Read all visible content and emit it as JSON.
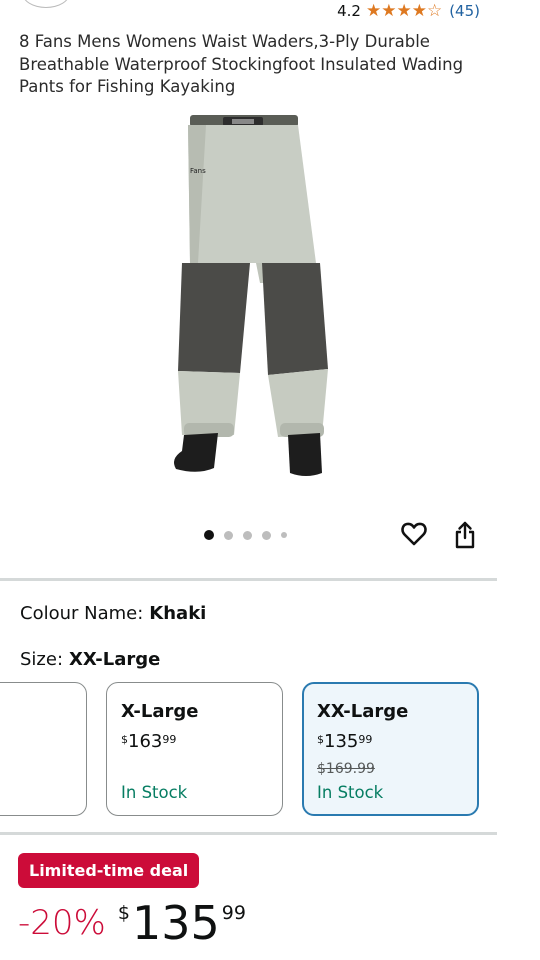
{
  "header": {
    "rating_value": "4.2",
    "rating_stars": "4.2 out of 5",
    "rating_count": "(45)"
  },
  "product": {
    "title": "8 Fans Mens Womens Waist Waders,3-Ply Durable Breathable Waterproof Stockingfoot Insulated Wading Pants for Fishing Kayaking",
    "image_logo_text": "Fans"
  },
  "carousel": {
    "dot_count": 5,
    "active_index": 0
  },
  "options": {
    "colour_label": "Colour Name:",
    "colour_value": "Khaki",
    "size_label": "Size:",
    "size_value": "XX-Large"
  },
  "sizes": [
    {
      "name": "X-Large",
      "price_symbol": "$",
      "price_whole": "163",
      "price_cents": "99",
      "strike_price": "",
      "stock": "In Stock",
      "selected": false
    },
    {
      "name": "XX-Large",
      "price_symbol": "$",
      "price_whole": "135",
      "price_cents": "99",
      "strike_price": "$169.99",
      "stock": "In Stock",
      "selected": true
    }
  ],
  "deal": {
    "badge": "Limited-time deal",
    "discount": "-20%",
    "price_symbol": "$",
    "price_whole": "135",
    "price_cents": "99"
  },
  "colors": {
    "star": "#de7921",
    "link": "#2162a1",
    "deal_red": "#cc0c39",
    "in_stock_green": "#067d62",
    "selected_border": "#2a7ab0",
    "selected_bg": "#eef6fb"
  },
  "icons": {
    "wishlist": "heart-icon",
    "share": "share-icon"
  }
}
